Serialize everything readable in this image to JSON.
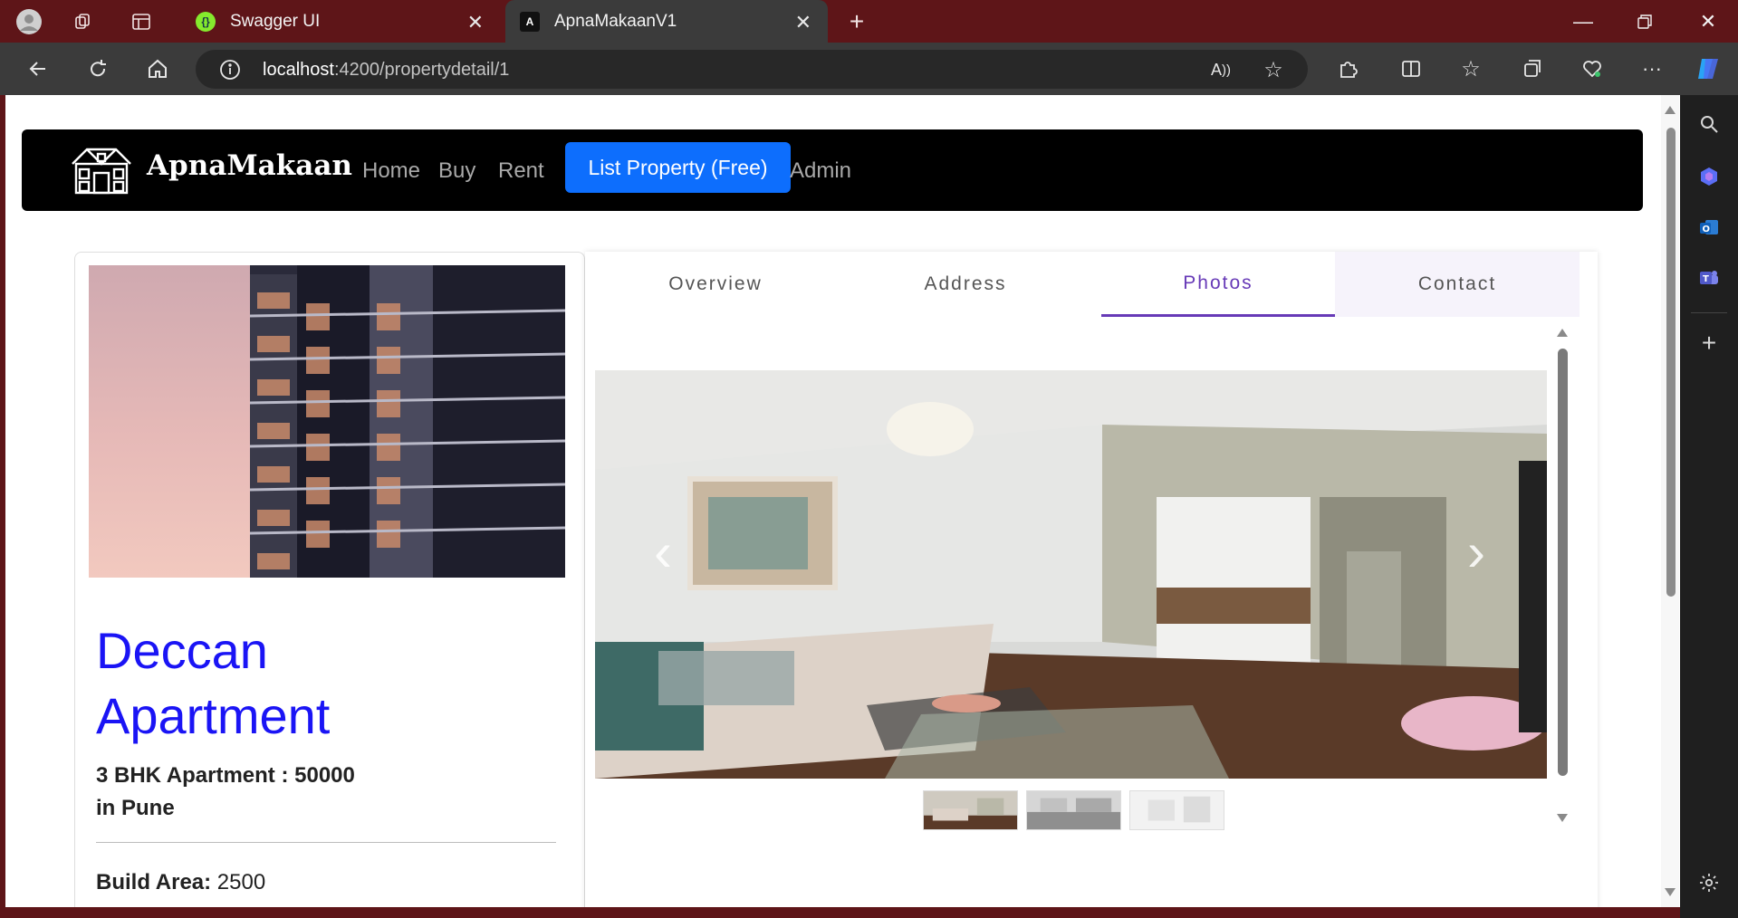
{
  "browser": {
    "tabs": [
      {
        "title": "Swagger UI",
        "favicon": "swagger-icon",
        "active": false
      },
      {
        "title": "ApnaMakaanV1",
        "favicon": "angular-icon",
        "active": true
      }
    ],
    "url": {
      "host": "localhost",
      "path": ":4200/propertydetail/1"
    }
  },
  "site": {
    "brand": "ApnaMakaan",
    "nav": [
      {
        "label": "Home"
      },
      {
        "label": "Buy"
      },
      {
        "label": "Rent"
      },
      {
        "label": "Admin"
      }
    ],
    "cta": "List Property (Free)"
  },
  "property": {
    "name": "Deccan Apartment",
    "type_line1": "3 BHK Apartment : 50000",
    "type_line2": "in Pune",
    "build_area_label": "Build Area:",
    "build_area_value": "2500"
  },
  "detail_tabs": [
    {
      "label": "Overview"
    },
    {
      "label": "Address"
    },
    {
      "label": "Photos",
      "active": true
    },
    {
      "label": "Contact"
    }
  ],
  "carousel": {
    "prev_icon": "chevron-left-icon",
    "next_icon": "chevron-right-icon",
    "thumbnail_count": 3
  },
  "colors": {
    "titlebar": "#5e1518",
    "site_navbar": "#000000",
    "cta_button": "#0d6efd",
    "property_name": "#1a14f5",
    "tab_active": "#673ab7"
  }
}
